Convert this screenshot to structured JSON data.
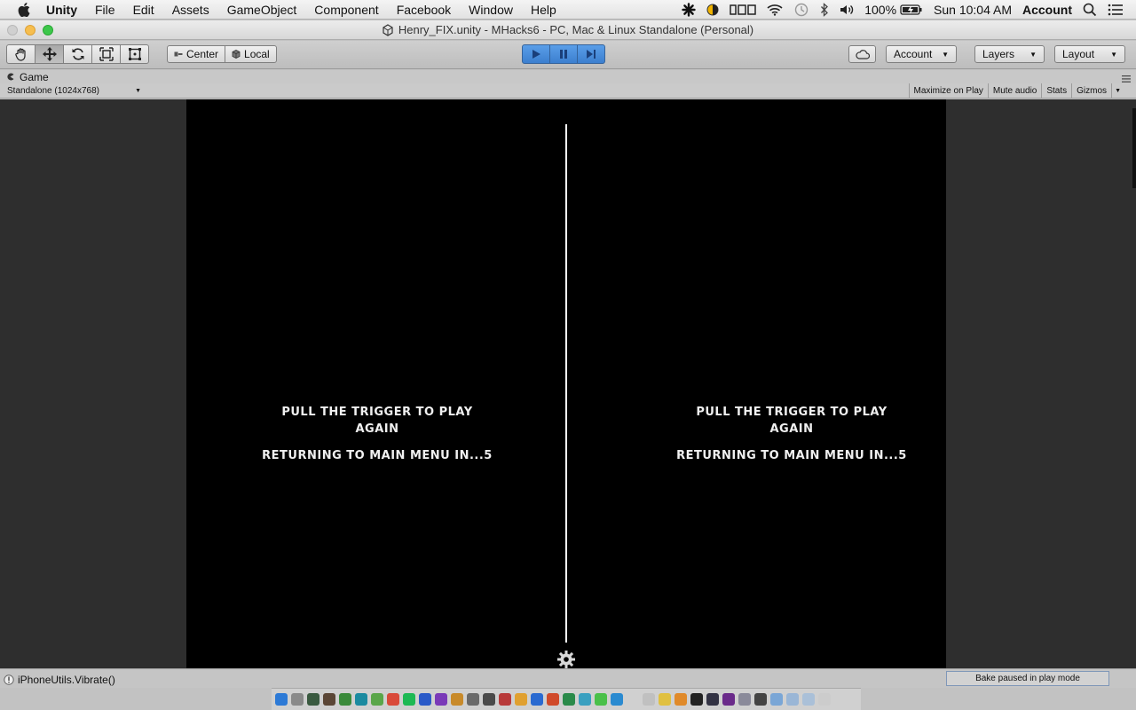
{
  "menubar": {
    "app": "Unity",
    "items": [
      "File",
      "Edit",
      "Assets",
      "GameObject",
      "Component",
      "Facebook",
      "Window",
      "Help"
    ],
    "battery": "100%",
    "clock": "Sun 10:04 AM",
    "user": "Account"
  },
  "window": {
    "title": "Henry_FIX.unity - MHacks6 - PC, Mac & Linux Standalone (Personal)"
  },
  "toolbar": {
    "pivot_center": "Center",
    "pivot_local": "Local",
    "account_label": "Account",
    "layers_label": "Layers",
    "layout_label": "Layout"
  },
  "game_view": {
    "tab_label": "Game",
    "resolution": "Standalone (1024x768)",
    "options": [
      "Maximize on Play",
      "Mute audio",
      "Stats",
      "Gizmos"
    ],
    "left_eye": {
      "line1": "PULL THE TRIGGER TO PLAY AGAIN",
      "line2": "RETURNING TO MAIN MENU IN...5"
    },
    "right_eye": {
      "line1": "PULL THE TRIGGER TO PLAY AGAIN",
      "line2": "RETURNING TO MAIN MENU IN...5"
    }
  },
  "statusbar": {
    "message": "iPhoneUtils.Vibrate()",
    "bake_status": "Bake paused in play mode"
  },
  "colors": {
    "play_active": "#3c7fcf",
    "game_bg": "#000000",
    "viewport_bg": "#2e2e2e"
  }
}
